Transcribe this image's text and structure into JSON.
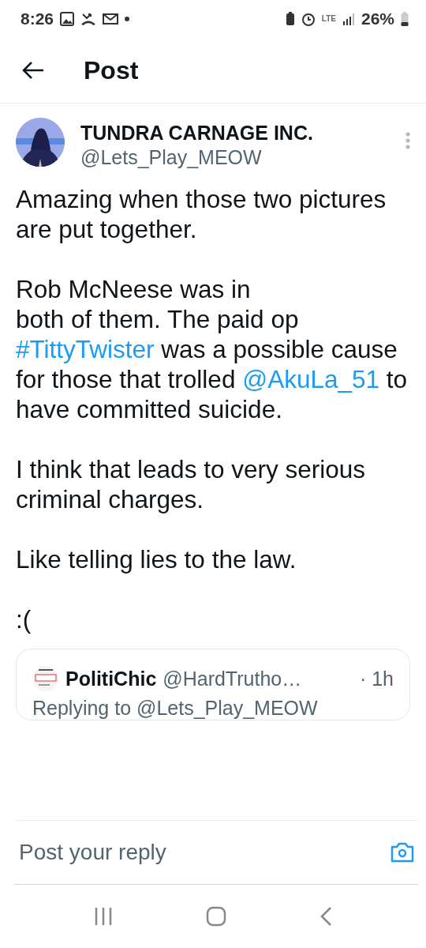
{
  "status_bar": {
    "time": "8:26",
    "network": "LTE",
    "battery": "26%"
  },
  "header": {
    "title": "Post"
  },
  "post": {
    "author": {
      "name": "TUNDRA CARNAGE INC.",
      "handle": "@Lets_Play_MEOW"
    },
    "paragraphs": [
      [
        {
          "kind": "text",
          "text": "Amazing when those two pictures are put together."
        }
      ],
      [
        {
          "kind": "text",
          "text": "Rob McNeese was in\nboth of them. The paid op "
        },
        {
          "kind": "hashtag",
          "text": "#TittyTwister"
        },
        {
          "kind": "text",
          "text": " was a possible cause for those that trolled "
        },
        {
          "kind": "mention",
          "text": "@AkuLa_51"
        },
        {
          "kind": "text",
          "text": " to have committed suicide."
        }
      ],
      [
        {
          "kind": "text",
          "text": "I think that leads to very serious criminal charges."
        }
      ],
      [
        {
          "kind": "text",
          "text": "Like telling lies to the law."
        }
      ],
      [
        {
          "kind": "text",
          "text": ":("
        }
      ]
    ],
    "quoted": {
      "name": "PolitiChic",
      "handle": "@HardTrutho…",
      "time": "· 1h",
      "replying": "Replying to @Lets_Play_MEOW"
    }
  },
  "reply_bar": {
    "placeholder": "Post your reply"
  }
}
